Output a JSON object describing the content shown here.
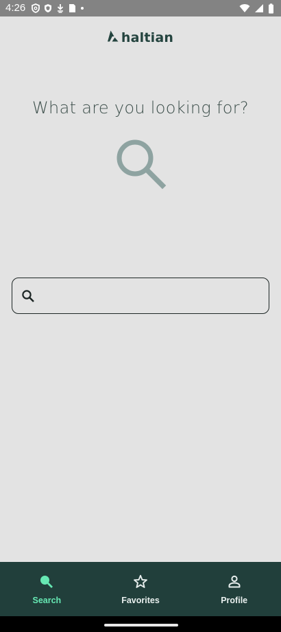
{
  "status_bar": {
    "time": "4:26",
    "left_icons": [
      "vpn-shield-icon",
      "security-shield-icon",
      "download-icon",
      "sim-card-icon",
      "dot-icon"
    ],
    "right_icons": [
      "wifi-icon",
      "cellular-signal-icon",
      "battery-icon"
    ]
  },
  "app": {
    "logo_text": "haltian",
    "heading": "What are you looking for?",
    "hero_icon": "search-icon"
  },
  "search": {
    "value": "",
    "placeholder": "",
    "icon": "search-icon"
  },
  "bottom_nav": {
    "items": [
      {
        "label": "Search",
        "icon": "search-icon",
        "active": true
      },
      {
        "label": "Favorites",
        "icon": "star-icon",
        "active": false
      },
      {
        "label": "Profile",
        "icon": "person-icon",
        "active": false
      }
    ]
  },
  "colors": {
    "brand_dark_green": "#213f3b",
    "active_accent": "#66e8b3",
    "background": "#e3e3e3",
    "hero_icon": "#8ea3a1"
  }
}
